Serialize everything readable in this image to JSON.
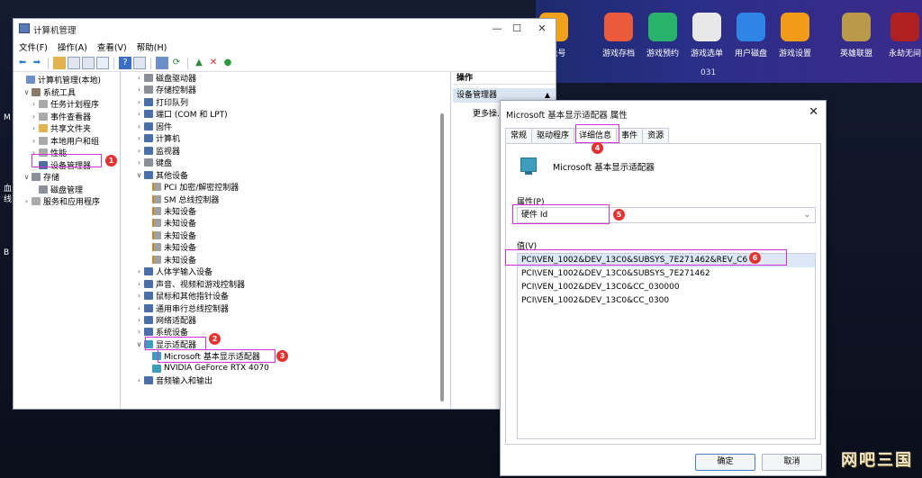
{
  "desktop": {
    "top_apps": [
      {
        "label": "m免号",
        "color": "#f2a21a"
      },
      {
        "label": "游戏存档",
        "color": "#ea5a3c"
      },
      {
        "label": "游戏预约",
        "color": "#29b36a"
      },
      {
        "label": "游戏选单",
        "color": "#e8e8e8"
      },
      {
        "label": "用户磁盘",
        "color": "#2f84e8"
      },
      {
        "label": "游戏设置",
        "color": "#f29a1a"
      },
      {
        "label": "英雄联盟",
        "color": "#b89a4a"
      },
      {
        "label": "永劫无间",
        "color": "#b02020"
      }
    ],
    "strip_number": "031",
    "left_letters": [
      "M",
      "血",
      "线",
      "B"
    ],
    "watermark": "网吧三国"
  },
  "cm_window": {
    "title": "计算机管理",
    "controls": {
      "min": "—",
      "max": "☐",
      "close": "✕"
    },
    "menu": [
      "文件(F)",
      "操作(A)",
      "查看(V)",
      "帮助(H)"
    ],
    "left_tree": [
      {
        "label": "计算机管理(本地)",
        "icon": "computer-icon",
        "arrow": ""
      },
      {
        "label": "系统工具",
        "icon": "tools-icon",
        "arrow": "∨"
      },
      {
        "label": "任务计划程序",
        "icon": "clock-icon",
        "arrow": "›"
      },
      {
        "label": "事件查看器",
        "icon": "event-icon",
        "arrow": "›"
      },
      {
        "label": "共享文件夹",
        "icon": "folder-icon",
        "arrow": "›"
      },
      {
        "label": "本地用户和组",
        "icon": "users-icon",
        "arrow": "›"
      },
      {
        "label": "性能",
        "icon": "performance-icon",
        "arrow": "›"
      },
      {
        "label": "设备管理器",
        "icon": "device-manager-icon",
        "arrow": ""
      },
      {
        "label": "存储",
        "icon": "storage-icon",
        "arrow": "∨"
      },
      {
        "label": "磁盘管理",
        "icon": "disk-icon",
        "arrow": ""
      },
      {
        "label": "服务和应用程序",
        "icon": "services-icon",
        "arrow": "›"
      }
    ],
    "device_tree": [
      {
        "label": "磁盘驱动器",
        "arrow": "›",
        "icon": "disk-icon"
      },
      {
        "label": "存储控制器",
        "arrow": "›",
        "icon": "storage-icon"
      },
      {
        "label": "打印队列",
        "arrow": "›",
        "icon": "printer-icon"
      },
      {
        "label": "端口 (COM 和 LPT)",
        "arrow": "›",
        "icon": "port-icon"
      },
      {
        "label": "固件",
        "arrow": "›",
        "icon": "firmware-icon"
      },
      {
        "label": "计算机",
        "arrow": "›",
        "icon": "computer-icon"
      },
      {
        "label": "监视器",
        "arrow": "›",
        "icon": "monitor-icon"
      },
      {
        "label": "键盘",
        "arrow": "›",
        "icon": "keyboard-icon"
      },
      {
        "label": "其他设备",
        "arrow": "∨",
        "icon": "other-devices-icon"
      },
      {
        "label": "PCI 加密/解密控制器",
        "arrow": "",
        "icon": "unknown-device-icon"
      },
      {
        "label": "SM 总线控制器",
        "arrow": "",
        "icon": "unknown-device-icon"
      },
      {
        "label": "未知设备",
        "arrow": "",
        "icon": "unknown-device-icon"
      },
      {
        "label": "未知设备",
        "arrow": "",
        "icon": "unknown-device-icon"
      },
      {
        "label": "未知设备",
        "arrow": "",
        "icon": "unknown-device-icon"
      },
      {
        "label": "未知设备",
        "arrow": "",
        "icon": "unknown-device-icon"
      },
      {
        "label": "未知设备",
        "arrow": "",
        "icon": "unknown-device-icon"
      },
      {
        "label": "人体学输入设备",
        "arrow": "›",
        "icon": "hid-icon"
      },
      {
        "label": "声音、视频和游戏控制器",
        "arrow": "›",
        "icon": "sound-icon"
      },
      {
        "label": "鼠标和其他指针设备",
        "arrow": "›",
        "icon": "mouse-icon"
      },
      {
        "label": "通用串行总线控制器",
        "arrow": "›",
        "icon": "usb-icon"
      },
      {
        "label": "网络适配器",
        "arrow": "›",
        "icon": "network-icon"
      },
      {
        "label": "系统设备",
        "arrow": "›",
        "icon": "system-icon"
      },
      {
        "label": "显示适配器",
        "arrow": "∨",
        "icon": "display-adapter-icon"
      },
      {
        "label": "Microsoft 基本显示适配器",
        "arrow": "",
        "icon": "gpu-icon"
      },
      {
        "label": "NVIDIA GeForce RTX 4070",
        "arrow": "",
        "icon": "gpu-icon"
      },
      {
        "label": "音频输入和输出",
        "arrow": "›",
        "icon": "audio-icon"
      }
    ],
    "actions": {
      "header": "操作",
      "section": "设备管理器",
      "more": "更多操..."
    }
  },
  "dialog": {
    "title": "Microsoft 基本显示适配器 属性",
    "close": "✕",
    "tabs": [
      "常规",
      "驱动程序",
      "详细信息",
      "事件",
      "资源"
    ],
    "active_tab": 2,
    "device_name": "Microsoft 基本显示适配器",
    "property_label": "属性(P)",
    "property_value": "硬件 Id",
    "value_label": "值(V)",
    "values": [
      "PCI\\VEN_1002&DEV_13C0&SUBSYS_7E271462&REV_C6",
      "PCI\\VEN_1002&DEV_13C0&SUBSYS_7E271462",
      "PCI\\VEN_1002&DEV_13C0&CC_030000",
      "PCI\\VEN_1002&DEV_13C0&CC_0300"
    ],
    "ok": "确定",
    "cancel": "取消"
  },
  "annotations": [
    "1",
    "2",
    "3",
    "4",
    "5",
    "6"
  ],
  "colors": {
    "callout": "#d530d8",
    "badge": "#e33232",
    "selection": "#dce8f6"
  }
}
